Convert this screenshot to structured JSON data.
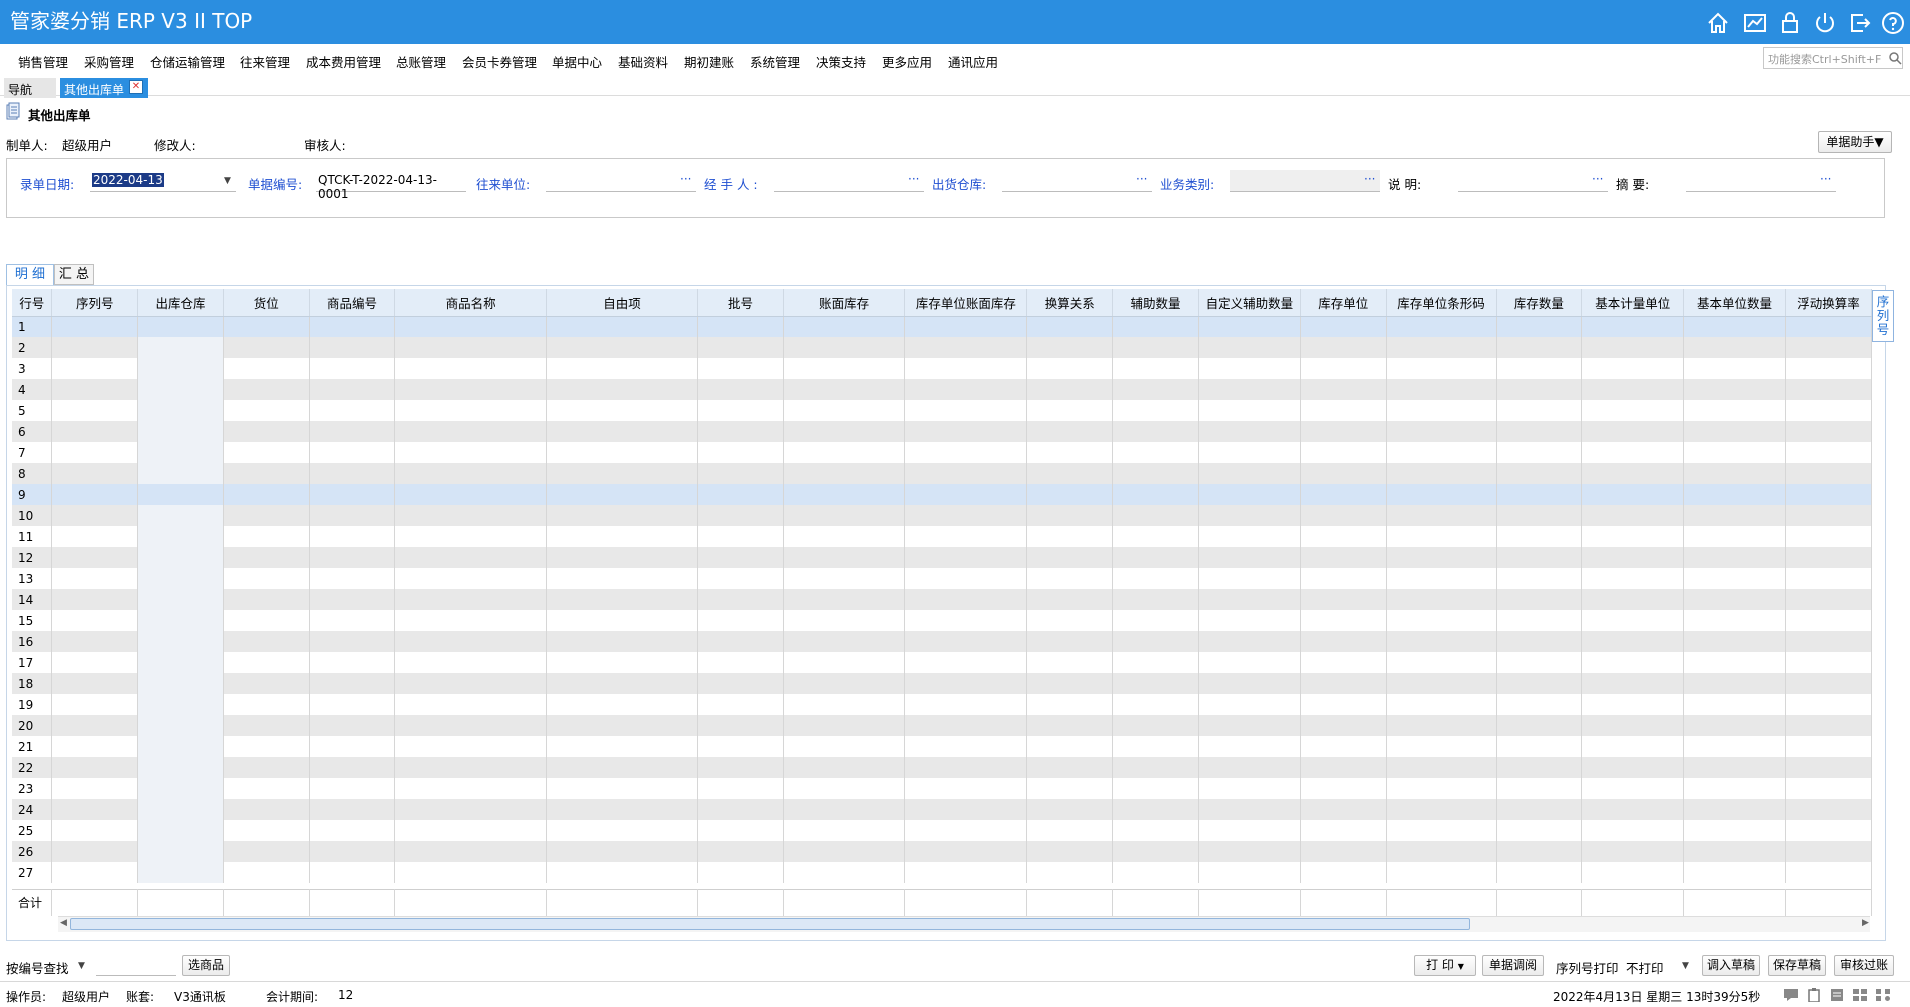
{
  "app": {
    "title": "管家婆分销 ERP V3 II TOP"
  },
  "menu": [
    "销售管理",
    "采购管理",
    "仓储运输管理",
    "往来管理",
    "成本费用管理",
    "总账管理",
    "会员卡券管理",
    "单据中心",
    "基础资料",
    "期初建账",
    "系统管理",
    "决策支持",
    "更多应用",
    "通讯应用"
  ],
  "search": {
    "placeholder": "功能搜索Ctrl+Shift+F"
  },
  "tabs": {
    "nav": "导航",
    "doc": "其他出库单"
  },
  "doc": {
    "title": "其他出库单",
    "maker_label": "制单人:",
    "maker": "超级用户",
    "modifier_label": "修改人:",
    "reviewer_label": "审核人:",
    "helper": "单据助手▼"
  },
  "form": {
    "date_label": "录单日期:",
    "date": "2022-04-13",
    "no_label": "单据编号:",
    "no": "QTCK-T-2022-04-13-0001",
    "partner_label": "往来单位:",
    "handler_label": "经 手 人 :",
    "warehouse_label": "出货仓库:",
    "biztype_label": "业务类别:",
    "note_label": "说      明:",
    "summary_label": "摘      要:",
    "dots": "···"
  },
  "subtabs": {
    "detail": "明 细",
    "summary": "汇 总"
  },
  "grid": {
    "columns": [
      "行号",
      "序列号",
      "出库仓库",
      "货位",
      "商品编号",
      "商品名称",
      "自由项",
      "批号",
      "账面库存",
      "库存单位账面库存",
      "换算关系",
      "辅助数量",
      "自定义辅助数量",
      "库存单位",
      "库存单位条形码",
      "库存数量",
      "基本计量单位",
      "基本单位数量",
      "浮动换算率"
    ],
    "rows": [
      "1",
      "2",
      "3",
      "4",
      "5",
      "6",
      "7",
      "8",
      "9",
      "10",
      "11",
      "12",
      "13",
      "14",
      "15",
      "16",
      "17",
      "18",
      "19",
      "20",
      "21",
      "22",
      "23",
      "24",
      "25",
      "26",
      "27"
    ],
    "total_label": "合计",
    "side_tab": "序列号"
  },
  "bottom": {
    "find_label": "按编号查找",
    "pick_goods": "选商品",
    "print": "打 印",
    "doc_review": "单据调阅",
    "serial_print_label": "序列号打印",
    "serial_print_value": "不打印",
    "load_draft": "调入草稿",
    "save_draft": "保存草稿",
    "approve": "审核过账"
  },
  "status": {
    "operator_label": "操作员:",
    "operator": "超级用户",
    "account_label": "账套:",
    "account": "V3通讯板",
    "period_label": "会计期间:",
    "period": "12",
    "datetime": "2022年4月13日  星期三  13时39分5秒"
  },
  "colors": {
    "accent": "#2b8ee0",
    "link": "#1f4fd1"
  }
}
